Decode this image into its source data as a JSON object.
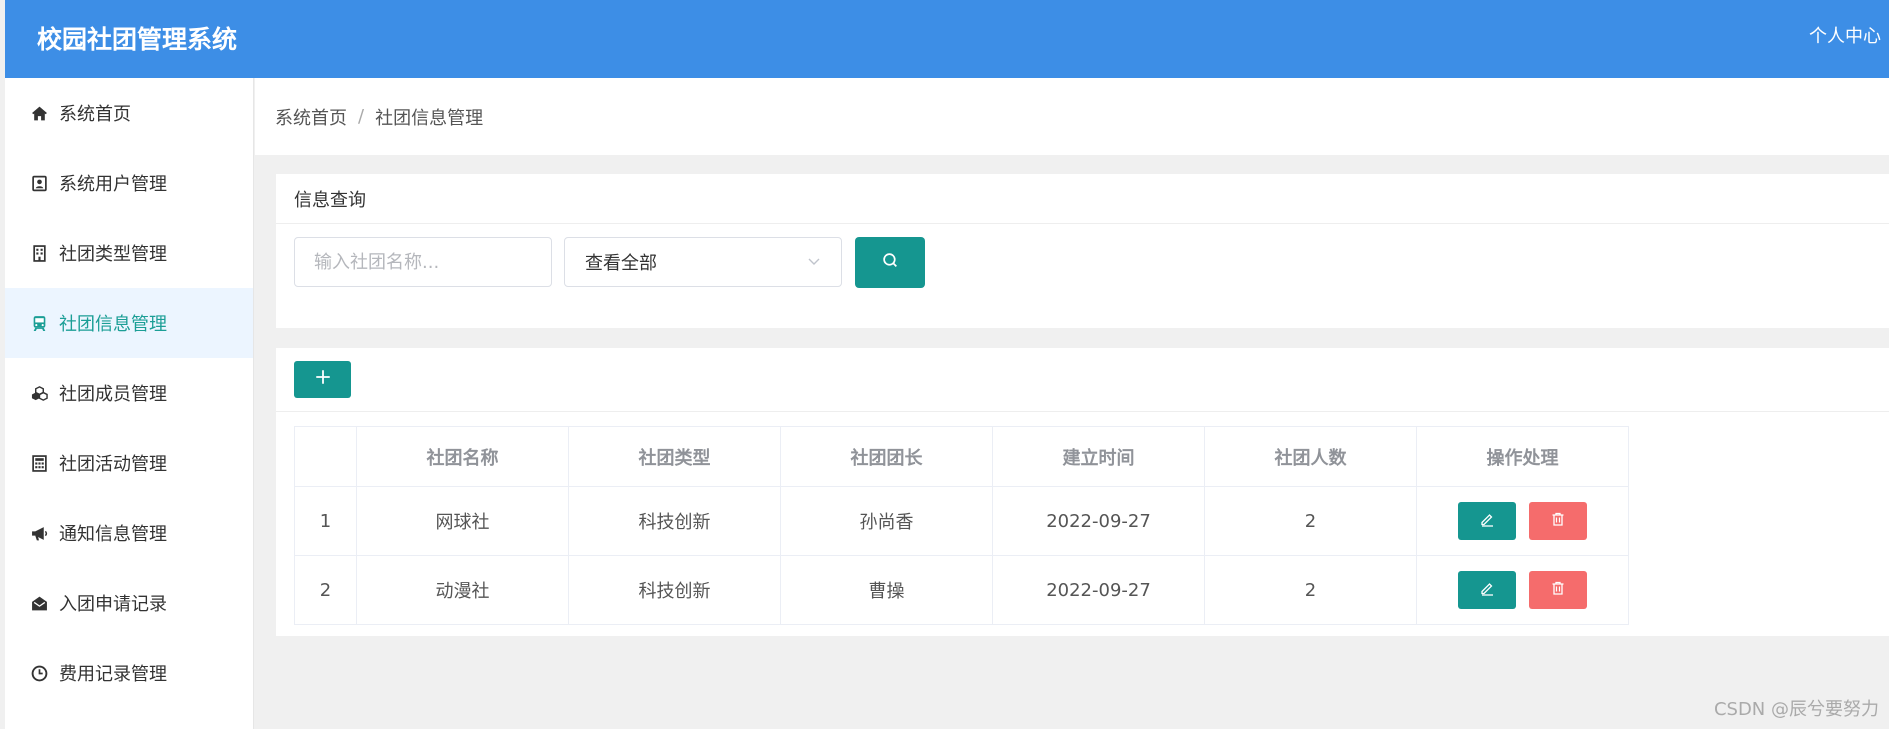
{
  "app": {
    "title": "校园社团管理系统",
    "user_menu": "个人中心"
  },
  "sidebar": {
    "items": [
      {
        "label": "系统首页",
        "icon": "home-icon"
      },
      {
        "label": "系统用户管理",
        "icon": "user-card-icon"
      },
      {
        "label": "社团类型管理",
        "icon": "building-icon"
      },
      {
        "label": "社团信息管理",
        "icon": "train-icon",
        "active": true
      },
      {
        "label": "社团成员管理",
        "icon": "cubes-icon"
      },
      {
        "label": "社团活动管理",
        "icon": "calculator-icon"
      },
      {
        "label": "通知信息管理",
        "icon": "megaphone-icon"
      },
      {
        "label": "入团申请记录",
        "icon": "envelope-open-icon"
      },
      {
        "label": "费用记录管理",
        "icon": "clock-icon"
      }
    ]
  },
  "breadcrumb": {
    "home": "系统首页",
    "separator": "/",
    "current": "社团信息管理"
  },
  "query": {
    "title": "信息查询",
    "search_placeholder": "输入社团名称...",
    "search_value": "",
    "select_value": "查看全部"
  },
  "table": {
    "headers": [
      "",
      "社团名称",
      "社团类型",
      "社团团长",
      "建立时间",
      "社团人数",
      "操作处理"
    ],
    "rows": [
      {
        "index": "1",
        "name": "网球社",
        "type": "科技创新",
        "leader": "孙尚香",
        "date": "2022-09-27",
        "count": "2"
      },
      {
        "index": "2",
        "name": "动漫社",
        "type": "科技创新",
        "leader": "曹操",
        "date": "2022-09-27",
        "count": "2"
      }
    ]
  },
  "colors": {
    "header": "#3d8ee6",
    "primary": "#159690",
    "danger": "#f56c6c",
    "active_bg": "#ecf5ff"
  },
  "watermark": "CSDN @辰兮要努力"
}
